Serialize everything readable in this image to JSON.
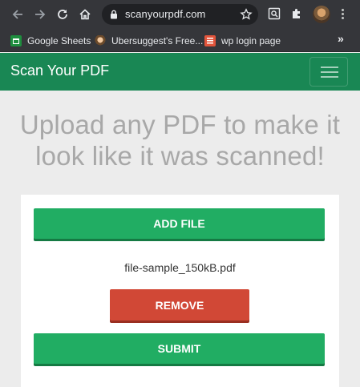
{
  "browser": {
    "url": "scanyourpdf.com",
    "bookmarks": [
      {
        "label": "Google Sheets",
        "icon": "google-sheets-icon"
      },
      {
        "label": "Ubersuggest's Free...",
        "icon": "ubersuggest-icon"
      },
      {
        "label": "wp login page",
        "icon": "wp-login-icon"
      }
    ],
    "overflow": "»"
  },
  "navbar": {
    "brand": "Scan Your PDF",
    "color": "#198754"
  },
  "headline": "Upload any PDF to make it look like it was scanned!",
  "card": {
    "add_label": "ADD FILE",
    "filename": "file-sample_150kB.pdf",
    "remove_label": "REMOVE",
    "submit_label": "SUBMIT"
  },
  "colors": {
    "button_green": "#21ad63",
    "button_red": "#d14836",
    "headline": "#a8a8a8",
    "page_bg": "#ececec"
  }
}
